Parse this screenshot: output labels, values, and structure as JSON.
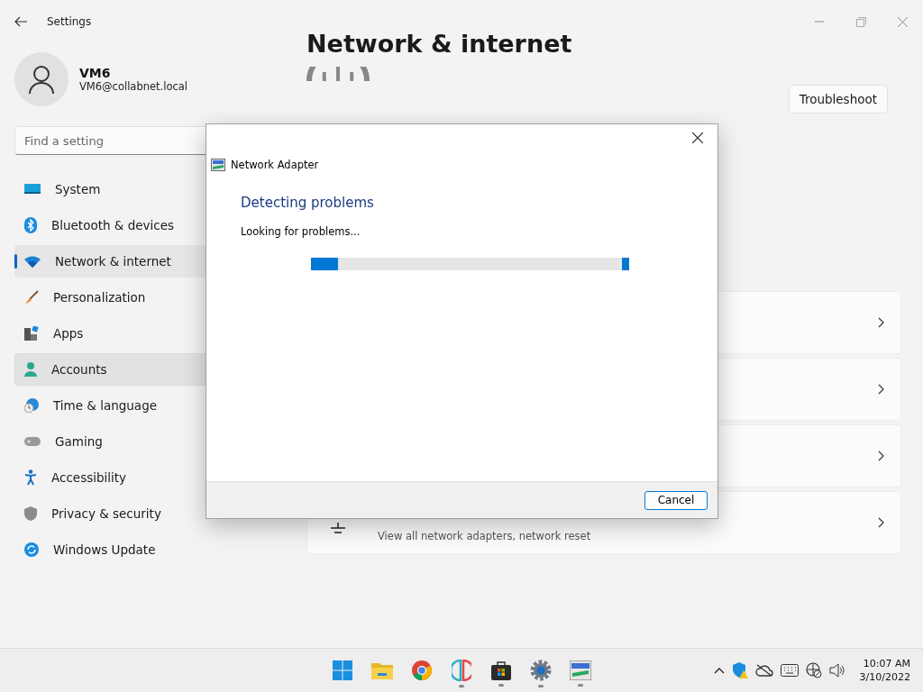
{
  "window": {
    "title": "Settings"
  },
  "user": {
    "name": "VM6",
    "email": "VM6@collabnet.local"
  },
  "search": {
    "placeholder": "Find a setting"
  },
  "sidebar": {
    "items": [
      {
        "label": "System",
        "selected": false,
        "hovered": false
      },
      {
        "label": "Bluetooth & devices",
        "selected": false,
        "hovered": false
      },
      {
        "label": "Network & internet",
        "selected": true,
        "hovered": false
      },
      {
        "label": "Personalization",
        "selected": false,
        "hovered": false
      },
      {
        "label": "Apps",
        "selected": false,
        "hovered": false
      },
      {
        "label": "Accounts",
        "selected": false,
        "hovered": true
      },
      {
        "label": "Time & language",
        "selected": false,
        "hovered": false
      },
      {
        "label": "Gaming",
        "selected": false,
        "hovered": false
      },
      {
        "label": "Accessibility",
        "selected": false,
        "hovered": false
      },
      {
        "label": "Privacy & security",
        "selected": false,
        "hovered": false
      },
      {
        "label": "Windows Update",
        "selected": false,
        "hovered": false
      }
    ]
  },
  "page": {
    "title": "Network & internet",
    "troubleshoot_button": "Troubleshoot",
    "cards": [
      {
        "kind": "plain"
      },
      {
        "kind": "plain"
      },
      {
        "kind": "plain"
      },
      {
        "kind": "detailed",
        "subtitle": "View all network adapters, network reset"
      }
    ]
  },
  "dialog": {
    "title": "Network Adapter",
    "heading": "Detecting problems",
    "status": "Looking for problems...",
    "progress": {
      "level": 0.085
    },
    "cancel_button": "Cancel"
  },
  "taskbar": {
    "apps": [
      {
        "running": false
      },
      {
        "running": false
      },
      {
        "running": false
      },
      {
        "running": true
      },
      {
        "running": true
      },
      {
        "running": true
      },
      {
        "running": true
      }
    ],
    "time": "10:07 AM",
    "date": "3/10/2022"
  }
}
